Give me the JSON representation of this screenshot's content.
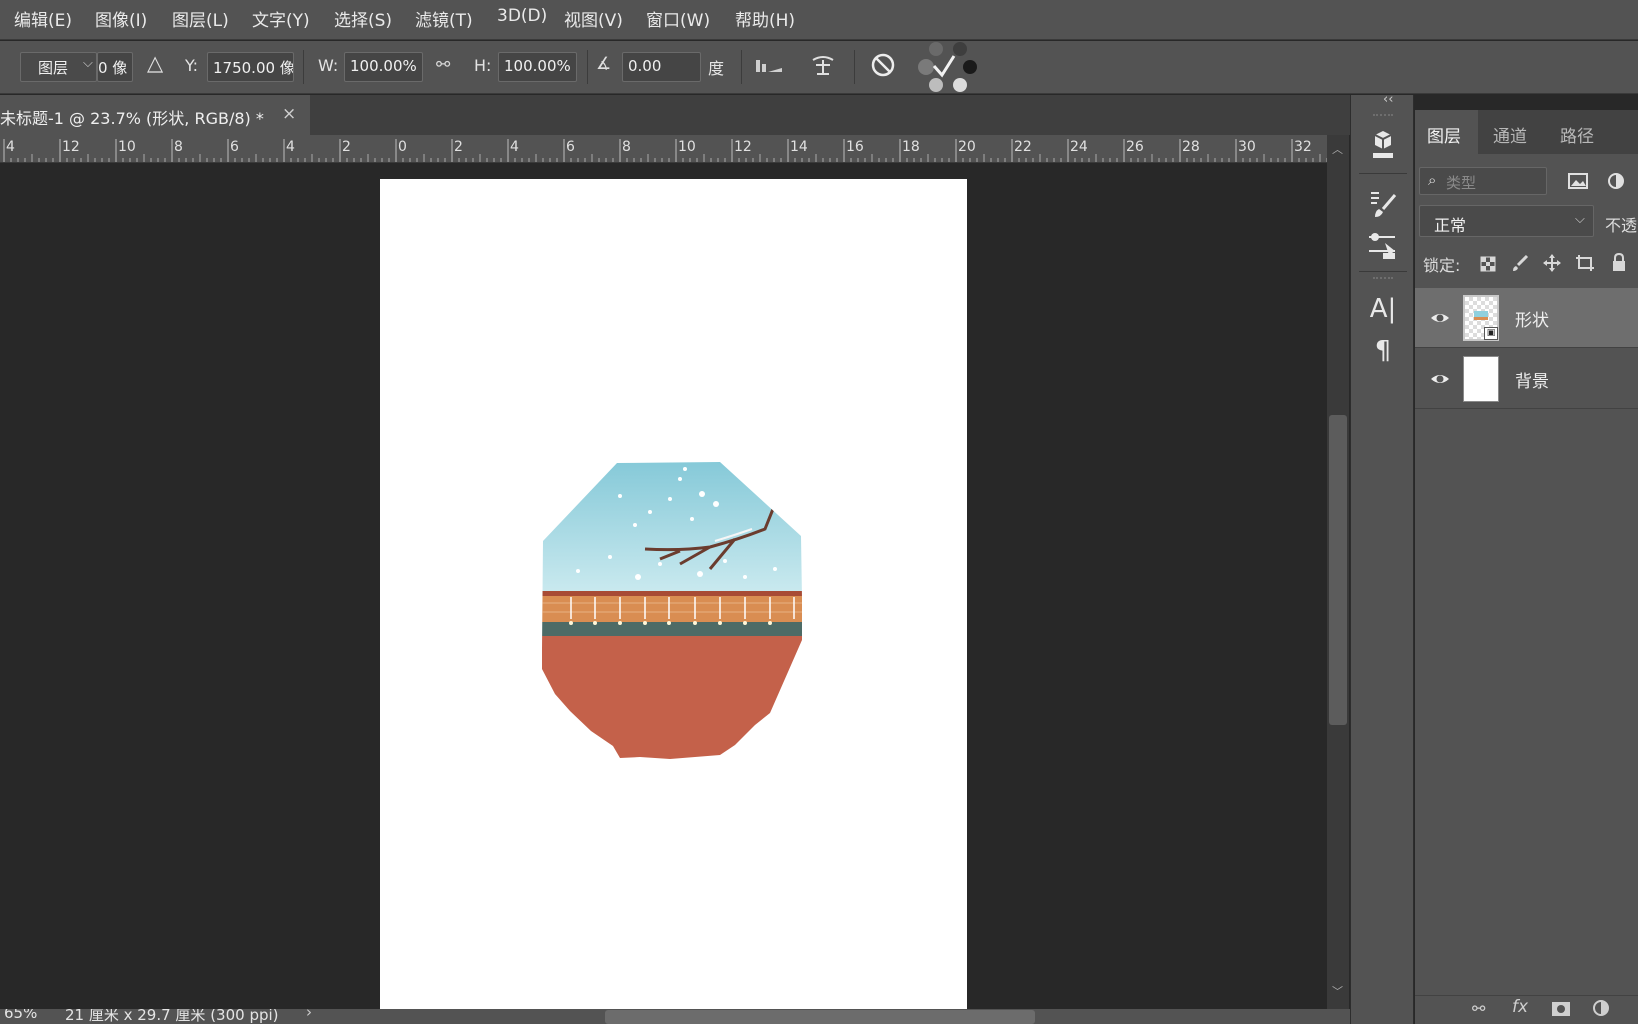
{
  "menu": [
    "编辑(E)",
    "图像(I)",
    "图层(L)",
    "文字(Y)",
    "选择(S)",
    "滤镜(T)",
    "3D(D)",
    "视图(V)",
    "窗口(W)",
    "帮助(H)"
  ],
  "options": {
    "reference": "图层",
    "x_value": "0 像",
    "y_label": "Y:",
    "y_value": "1750.00 像",
    "w_label": "W:",
    "w_value": "100.00%",
    "h_label": "H:",
    "h_value": "100.00%",
    "angle_value": "0.00",
    "angle_unit": "度"
  },
  "document": {
    "tab_title": "未标题-1 @ 23.7% (形状, RGB/8) *",
    "close": "×"
  },
  "ruler": [
    "4",
    "12",
    "10",
    "8",
    "6",
    "4",
    "2",
    "0",
    "2",
    "4",
    "6",
    "8",
    "10",
    "12",
    "14",
    "16",
    "18",
    "20",
    "22",
    "24",
    "26",
    "28",
    "30",
    "32"
  ],
  "status": {
    "zoom": "65%",
    "doc_info": "21 厘米 x 29.7 厘米 (300 ppi)",
    "arrow": "›"
  },
  "panel": {
    "tabs": [
      "图层",
      "通道",
      "路径"
    ],
    "filter_placeholder": "类型",
    "blend_mode": "正常",
    "opacity_label": "不透",
    "lock_label": "锁定:",
    "layers": [
      {
        "name": "形状",
        "selected": true
      },
      {
        "name": "背景",
        "selected": false
      }
    ],
    "collapse": "‹‹"
  },
  "colors": {
    "sky": "#a9dbe6",
    "terracotta": "#c4614a",
    "orange_beam": "#d98d52",
    "green_band": "#4d6b66"
  }
}
